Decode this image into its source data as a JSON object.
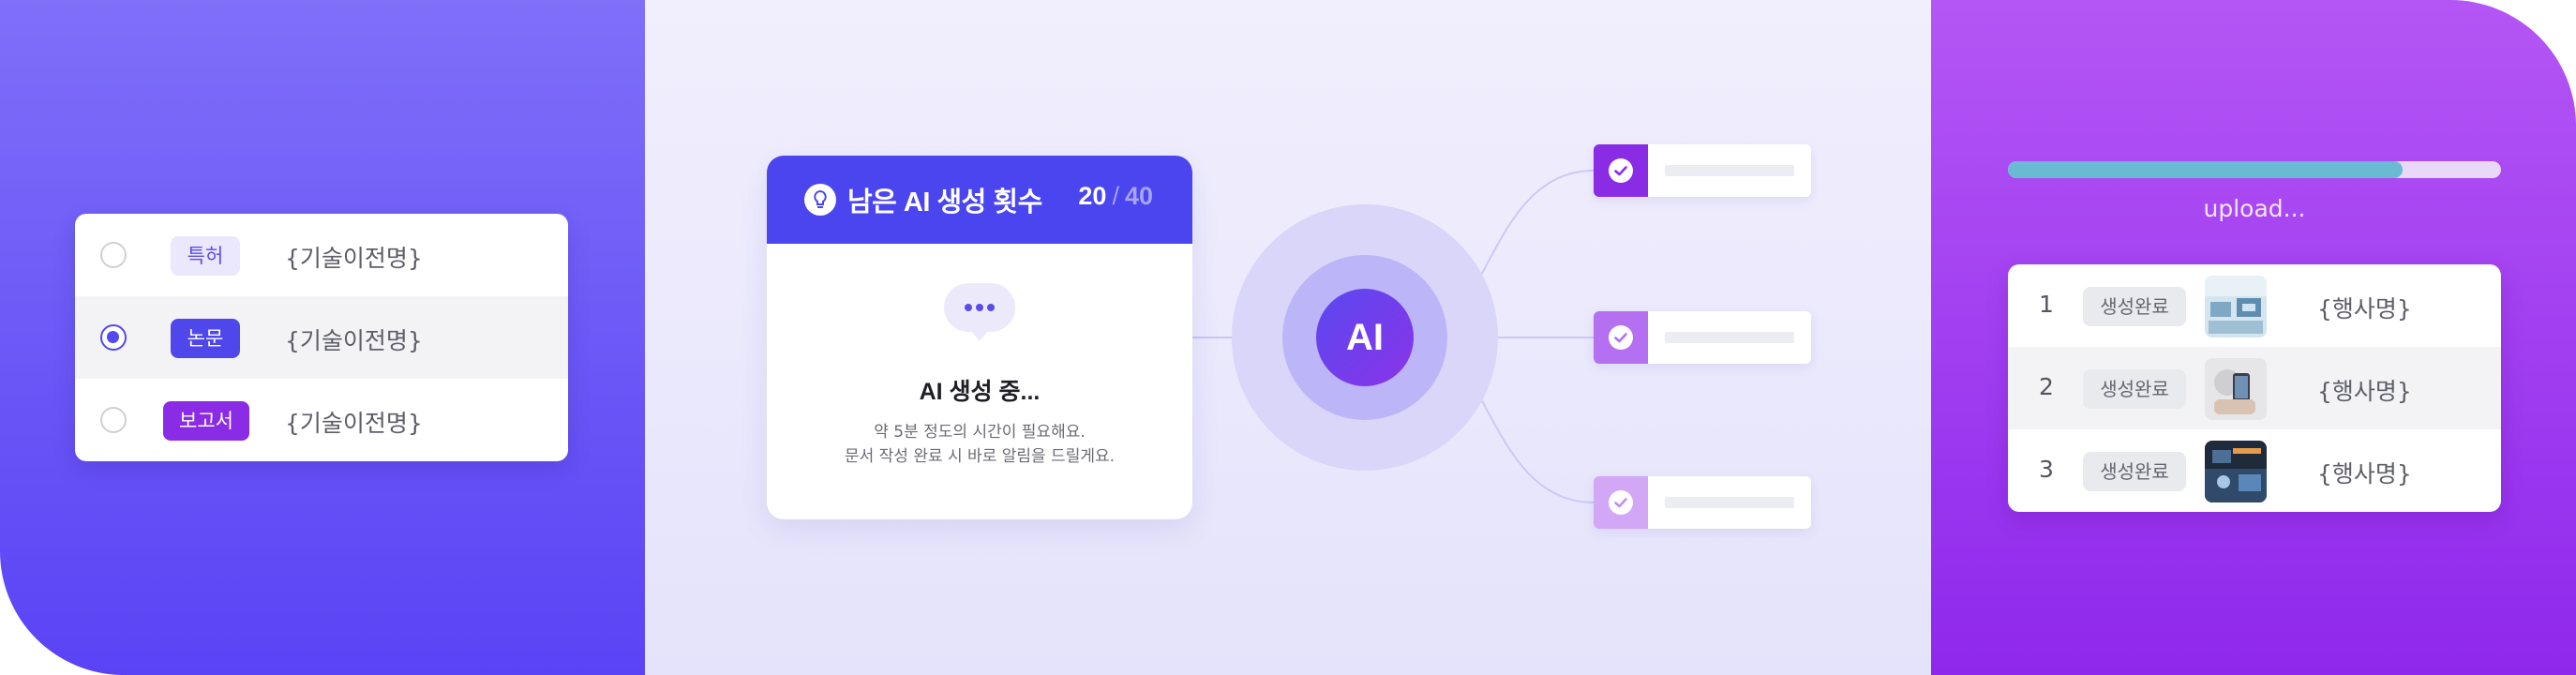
{
  "left_panel": {
    "rows": [
      {
        "tag": "특허",
        "name": "{기술이전명}",
        "selected": false
      },
      {
        "tag": "논문",
        "name": "{기술이전명}",
        "selected": true
      },
      {
        "tag": "보고서",
        "name": "{기술이전명}",
        "selected": false
      }
    ]
  },
  "generator": {
    "title": "남은 AI 생성 횟수",
    "used": "20",
    "slash": "/",
    "total": "40",
    "status": "AI 생성 중...",
    "desc_line1": "약 5분 정도의 시간이 필요해요.",
    "desc_line2": "문서 작성 완료 시 바로 알림을 드릴게요.",
    "ai_label": "AI",
    "result_colors": [
      "#8a2be6",
      "#b470f0",
      "#d1a7f6"
    ]
  },
  "right_panel": {
    "progress": 0.8,
    "upload_label": "upload...",
    "rows": [
      {
        "num": "1",
        "status": "생성완료",
        "name": "{행사명}"
      },
      {
        "num": "2",
        "status": "생성완료",
        "name": "{행사명}"
      },
      {
        "num": "3",
        "status": "생성완료",
        "name": "{행사명}"
      }
    ]
  },
  "colors": {
    "primary": "#4a45ee",
    "accent_purple": "#8a2be6",
    "progress": "#6bbad4"
  }
}
